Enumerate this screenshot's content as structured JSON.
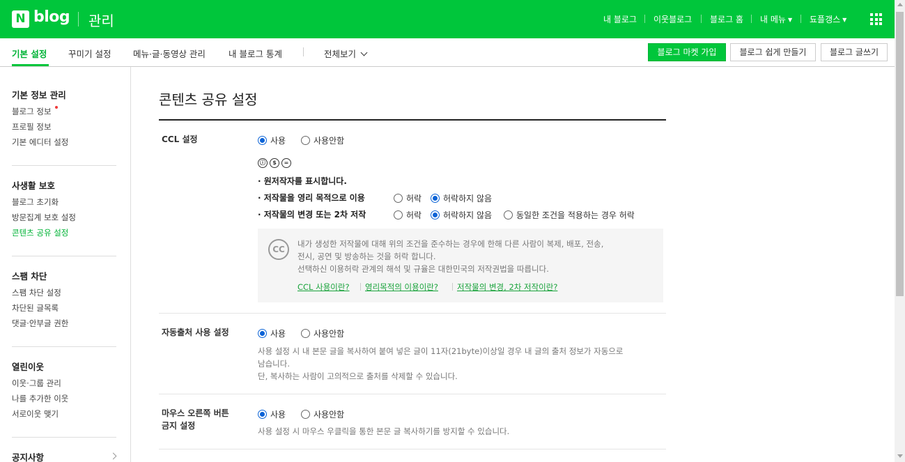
{
  "topbar": {
    "logo_letter": "N",
    "logo_text": "blog",
    "section_title": "관리",
    "nav": [
      {
        "label": "내 블로그"
      },
      {
        "label": "이웃블로그"
      },
      {
        "label": "블로그 홈"
      },
      {
        "label": "내 메뉴"
      },
      {
        "label": "됴플갱스"
      }
    ],
    "apps_icon": "grid-icon"
  },
  "subnav": {
    "tabs": [
      {
        "label": "기본 설정",
        "active": true
      },
      {
        "label": "꾸미기 설정"
      },
      {
        "label": "메뉴·글·동영상 관리"
      },
      {
        "label": "내 블로그 통계"
      },
      {
        "label": "전체보기"
      }
    ],
    "buttons": {
      "market": "블로그 마켓 가입",
      "easy": "블로그 쉽게 만들기",
      "write": "블로그 글쓰기"
    }
  },
  "sidebar": {
    "groups": [
      {
        "title": "기본 정보 관리",
        "items": [
          "블로그 정보",
          "프로필 정보",
          "기본 에디터 설정"
        ]
      },
      {
        "title": "사생활 보호",
        "items": [
          "블로그 초기화",
          "방문집계 보호 설정",
          "콘텐츠 공유 설정"
        ]
      },
      {
        "title": "스팸 차단",
        "items": [
          "스팸 차단 설정",
          "차단된 글목록",
          "댓글·안부글 권한"
        ]
      },
      {
        "title": "열린이웃",
        "items": [
          "이웃·그룹 관리",
          "나를 추가한 이웃",
          "서로이웃 맺기"
        ]
      },
      {
        "title": "공지사항",
        "items": []
      }
    ]
  },
  "main": {
    "title": "콘텐츠 공유 설정",
    "ccl": {
      "label": "CCL 설정",
      "use": "사용",
      "not_use": "사용안함",
      "selected": "사용",
      "icons": [
        "ⓘ",
        "$",
        "="
      ],
      "attribution": "· 원저작자를 표시합니다.",
      "commercial_label": "· 저작물을 영리 목적으로 이용",
      "allow": "허락",
      "disallow": "허락하지 않음",
      "modify_label": "· 저작물의 변경 또는 2차 저작",
      "share_alike": "동일한 조건을 적용하는 경우 허락",
      "info_badge": "CC",
      "info_lines": [
        "내가 생성한 저작물에 대해 위의 조건을 준수하는 경우에 한해 다른 사람이 복제, 배포, 전송,",
        "전시, 공연 및 방송하는 것을 허락 합니다.",
        "선택하신 이용허락 관계의 해석 및 규율은 대한민국의 저작권법을 따릅니다."
      ],
      "links": [
        "CCL 사용이란?",
        "영리목적의 이용이란?",
        "저작물의 변경, 2차 저작이란?"
      ]
    },
    "auto_source": {
      "label": "자동출처 사용 설정",
      "use": "사용",
      "not_use": "사용안함",
      "selected": "사용",
      "desc_lines": [
        "사용 설정 시 내 본문 글을 복사하여 붙여 넣은 글이 11자(21byte)이상일 경우 내 글의 출처 정보가 자동으로",
        "남습니다.",
        "단, 복사하는 사람이 고의적으로 출처를 삭제할 수 있습니다."
      ]
    },
    "right_click": {
      "label_line1": "마우스 오른쪽 버튼",
      "label_line2": "금지 설정",
      "use": "사용",
      "not_use": "사용안함",
      "selected": "사용",
      "desc": "사용 설정 시 마우스 우클릭을 통한 본문 글 복사하기를 방지할 수 있습니다."
    }
  },
  "colors": {
    "brand_green": "#00c63b",
    "link_green": "#19a33b",
    "radio_blue": "#0b63d6"
  }
}
